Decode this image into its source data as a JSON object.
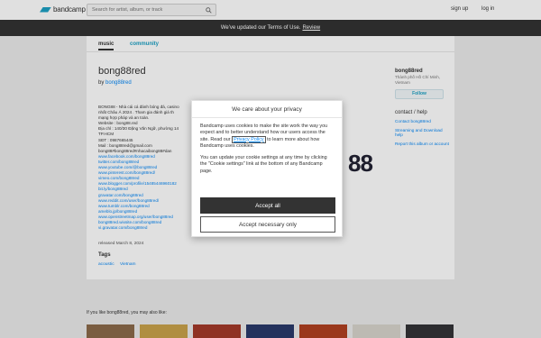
{
  "header": {
    "logo_text": "bandcamp",
    "search_placeholder": "Search for artist, album, or track",
    "signup_label": "sign up",
    "login_label": "log in"
  },
  "notice": {
    "text": "We've updated our Terms of Use.",
    "link": "Review"
  },
  "tabs": {
    "music": "music",
    "community": "community"
  },
  "artist": {
    "name": "bong88red",
    "by_prefix": "by",
    "by_name": "bong88red"
  },
  "about_lines": [
    {
      "text": "BONG88 - Nhà cái cá đánh bóng đá, casino",
      "link": false
    },
    {
      "text": "nhất Châu Á 2024 . Tham gia đánh giá th",
      "link": false
    },
    {
      "text": "mạng hợp pháp và an toàn.",
      "link": false
    },
    {
      "text": "Website : bong88.red",
      "link": false
    },
    {
      "text": "Địa chỉ : 140/30 Đặng Văn Ngữ, phường 14",
      "link": false
    },
    {
      "text": "TP.HCM",
      "link": false
    },
    {
      "text": "SĐT : 0987665445",
      "link": false
    },
    {
      "text": "Mail : bong88red@gmail.com",
      "link": false
    },
    {
      "text": "bong88#bong88red#nhacaibong88#dan",
      "link": false
    },
    {
      "text": "www.facebook.com/bong88red",
      "link": true
    },
    {
      "text": "twitter.com/bong88red",
      "link": true
    },
    {
      "text": "www.youtube.com/@bong88red",
      "link": true
    },
    {
      "text": "www.pinterest.com/bong88red/",
      "link": true
    },
    {
      "text": "vimeo.com/bong88red",
      "link": true
    },
    {
      "text": "www.blogger.com/profile/15485446960182",
      "link": true
    },
    {
      "text": "bit.ly/bong88red",
      "link": true
    },
    {
      "text": "gravatar.com/bong88red",
      "link": true
    },
    {
      "text": "www.reddit.com/user/bong88red/",
      "link": true
    },
    {
      "text": "www.tumblr.com/bong88red",
      "link": true
    },
    {
      "text": "ameblo.jp/bong88red",
      "link": true
    },
    {
      "text": "www.openstreetmap.org/user/bong88red",
      "link": true
    },
    {
      "text": "bong88red.wixsite.com/bong88red",
      "link": true
    },
    {
      "text": "vi.gravatar.com/bong88red",
      "link": true
    }
  ],
  "released": "released March 8, 2024",
  "tags_heading": "Tags",
  "tags": [
    "acoustic",
    "Vietnam"
  ],
  "cover_text": "88",
  "sidebar": {
    "name": "bong88red",
    "location": "Thành phố Hồ Chí Minh, Vietnam",
    "follow_label": "Follow",
    "contact_heading": "contact / help",
    "links": [
      "Contact bong88red",
      "Streaming and Download help",
      "Report this album or account"
    ]
  },
  "also_like": "If you like bong88red, you may also like:",
  "thumbs": [
    "#8b6a4a",
    "#c9a24a",
    "#a33a2a",
    "#2a3a6a",
    "#b04020",
    "#d8d4cc",
    "#333336"
  ],
  "modal": {
    "title": "We care about your privacy",
    "p1_before": "Bandcamp uses cookies to make the site work the way you expect and to better understand how our users access the site. Read our",
    "p1_link": "Privacy Policy",
    "p1_after": "to learn more about how Bandcamp uses cookies.",
    "p2": "You can update your cookie settings at any time by clicking the \"Cookie settings\" link at the bottom of any Bandcamp page.",
    "accept_label": "Accept all",
    "necessary_label": "Accept necessary only"
  }
}
